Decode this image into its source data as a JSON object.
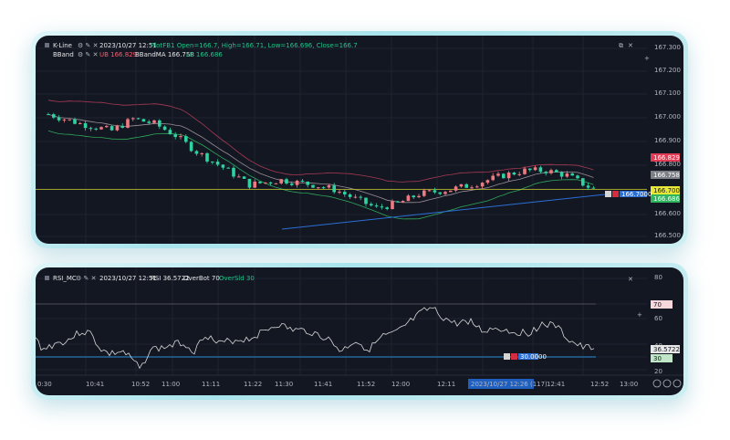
{
  "top_panel": {
    "symbol_label": "K-Line",
    "timestamp": "2023/10/27 12:51",
    "ohlc_text": "PlotFB1 Open=166.7, High=166.71, Low=166.696, Close=166.7",
    "indicator_name": "BBand",
    "ub_text": "UB 166.829",
    "ma_text": "BBandMA 166.758",
    "lb_text": "LB 166.686",
    "price_ticks": [
      "167.300",
      "167.200",
      "167.100",
      "167.000",
      "166.900",
      "166.800",
      "166.600",
      "166.500"
    ],
    "tags": {
      "ub": "166.829",
      "ma": "166.758",
      "current": "166.700",
      "lb": "166.686"
    },
    "marker_label": "166.7000",
    "colors": {
      "up": "#f07a82",
      "down": "#2fd2a0",
      "ub": "#c0566a",
      "ma": "#a2949c",
      "lb": "#2fa85a",
      "trend": "#2b6fd6",
      "hline": "#d6d62a"
    }
  },
  "bottom_panel": {
    "indicator_label": "RSI_MC",
    "timestamp": "2023/10/27 12:51",
    "rsi_text": "RSI 36.5722",
    "overbot_text": "OverBot 70",
    "oversld_text": "OverSld 30",
    "rsi_ticks": [
      "80",
      "60",
      "40",
      "20"
    ],
    "tags": {
      "overbot": "70",
      "rsi": "36.5722",
      "oversld": "30"
    },
    "marker_label": "30.0000",
    "time_ticks": [
      "0:30",
      "10:41",
      "10:52",
      "11:00",
      "11:11",
      "11:22",
      "11:30",
      "11:41",
      "11:52",
      "12:00",
      "12:11",
      "12:41",
      "12:52",
      "13:00"
    ],
    "crosshair_time": "2023/10/27 12:26 (117)"
  }
}
